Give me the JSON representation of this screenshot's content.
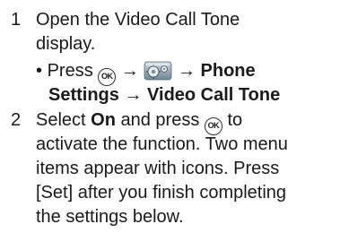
{
  "steps": [
    {
      "number": "1",
      "lines": [
        "Open the Video Call Tone",
        "display."
      ],
      "sub": {
        "bullet": "•",
        "press": "Press",
        "ok_key": "OK",
        "arrow": "→",
        "icon": "settings-icon",
        "item1": "Phone",
        "item2": "Settings",
        "item3": "Video Call Tone"
      }
    },
    {
      "number": "2",
      "select": "Select",
      "on": "On",
      "and_press": "and press",
      "ok_key": "OK",
      "to": "to",
      "lines": [
        "activate the function. Two menu",
        "items appear with icons. Press",
        "[Set] after you finish completing",
        "the settings below."
      ]
    }
  ]
}
